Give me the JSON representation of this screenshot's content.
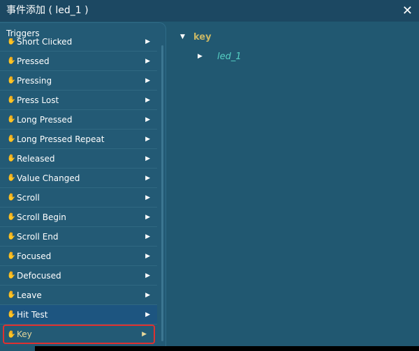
{
  "window": {
    "title": "事件添加 ( led_1 )",
    "close_icon": "✕"
  },
  "triggers": {
    "title": "Triggers",
    "items": [
      {
        "label": "Short Clicked"
      },
      {
        "label": "Pressed"
      },
      {
        "label": "Pressing"
      },
      {
        "label": "Press Lost"
      },
      {
        "label": "Long Pressed"
      },
      {
        "label": "Long Pressed Repeat"
      },
      {
        "label": "Released"
      },
      {
        "label": "Value Changed"
      },
      {
        "label": "Scroll"
      },
      {
        "label": "Scroll Begin"
      },
      {
        "label": "Scroll End"
      },
      {
        "label": "Focused"
      },
      {
        "label": "Defocused"
      },
      {
        "label": "Leave"
      },
      {
        "label": "Hit Test"
      },
      {
        "label": "Key"
      }
    ],
    "selected": "Key",
    "highlight_color": "#e03030"
  },
  "tree": {
    "root": "key",
    "child": "led_1"
  }
}
